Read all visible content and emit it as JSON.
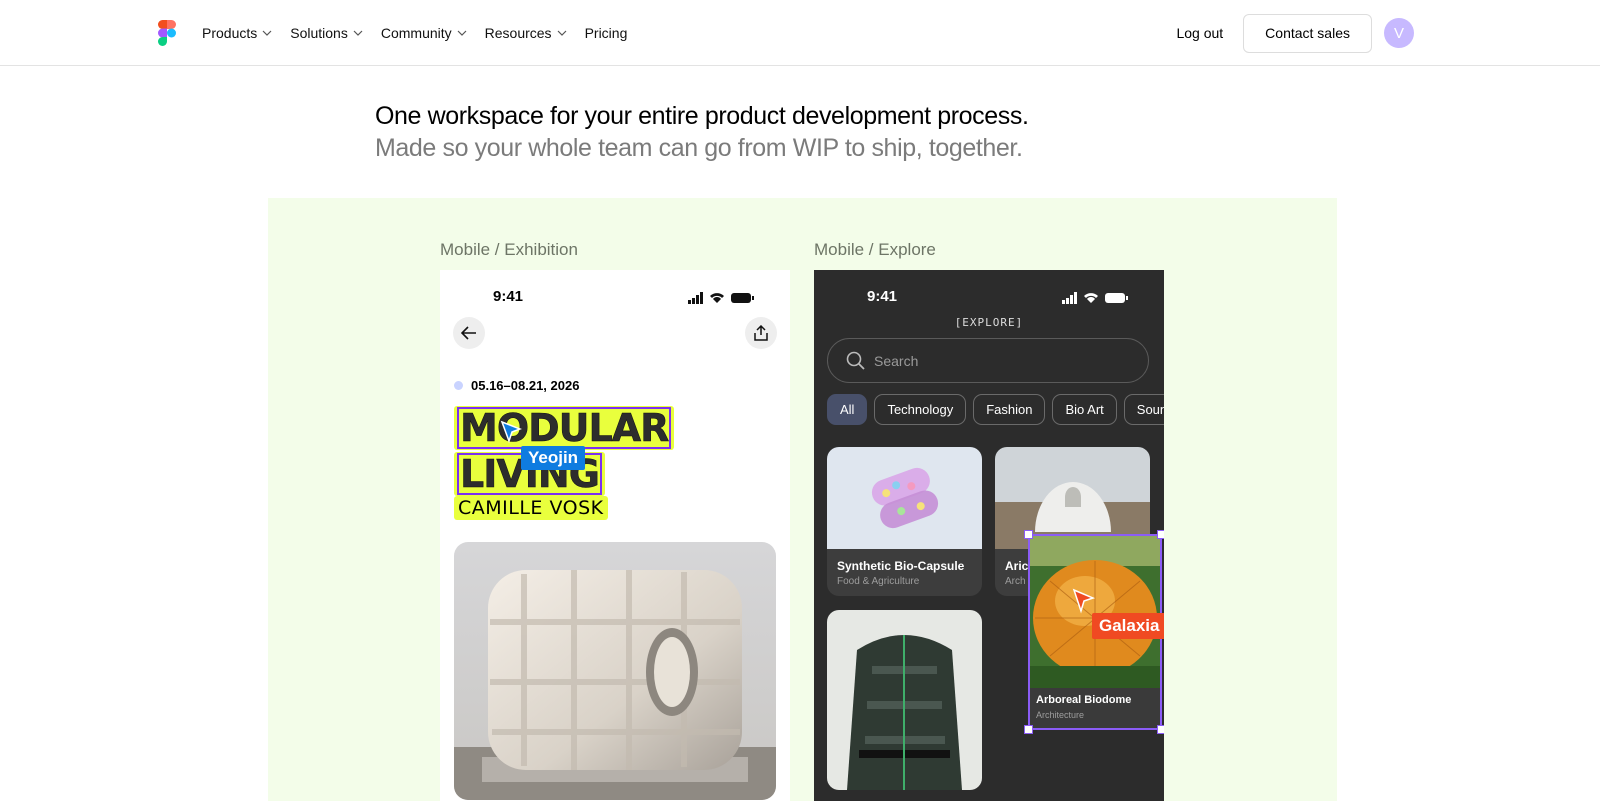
{
  "nav": {
    "items": [
      {
        "label": "Products",
        "has_menu": true
      },
      {
        "label": "Solutions",
        "has_menu": true
      },
      {
        "label": "Community",
        "has_menu": true
      },
      {
        "label": "Resources",
        "has_menu": true
      },
      {
        "label": "Pricing",
        "has_menu": false
      }
    ],
    "logout_label": "Log out",
    "contact_label": "Contact sales",
    "avatar_initial": "V"
  },
  "hero": {
    "line1": "One workspace for your entire product development process.",
    "line2": "Made so your whole team can go from WIP to ship, together."
  },
  "frames": {
    "exhibition": {
      "label": "Mobile / Exhibition",
      "time": "9:41",
      "date": "05.16–08.21, 2026",
      "title_line1": "MODULAR",
      "title_line2": "LIVING",
      "author": "CAMILLE VOSK",
      "cursor_name": "Yeojin"
    },
    "explore": {
      "label": "Mobile / Explore",
      "time": "9:41",
      "header": "[EXPLORE]",
      "search_placeholder": "Search",
      "chips": [
        "All",
        "Technology",
        "Fashion",
        "Bio Art",
        "Soun"
      ],
      "cards": [
        {
          "title": "Synthetic Bio-Capsule",
          "category": "Food & Agriculture"
        },
        {
          "title": "Aric",
          "category": "Arch"
        },
        {
          "title": "Arboreal Biodome",
          "category": "Architecture"
        }
      ],
      "cursor_name": "Galaxia"
    }
  },
  "colors": {
    "stage_bg": "#f3fde9",
    "highlight": "#e9ff3d",
    "yeojin": "#0f7ce0",
    "galaxia": "#f04a22",
    "selection": "#8b5cf6"
  }
}
